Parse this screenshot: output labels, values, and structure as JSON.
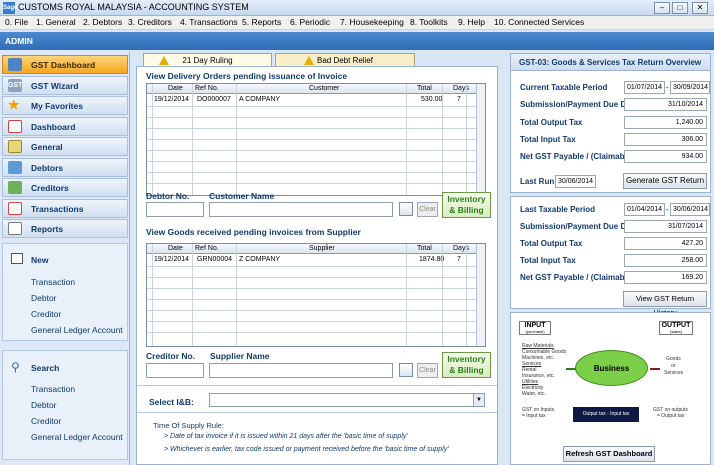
{
  "window": {
    "title": "CUSTOMS ROYAL MALAYSIA - ACCOUNTING SYSTEM",
    "logo": "Sage"
  },
  "menu": [
    "0. File",
    "1. General",
    "2. Debtors",
    "3. Creditors",
    "4. Transactions",
    "5. Reports",
    "6. Periodic",
    "7. Housekeeping",
    "8. Toolkits",
    "9. Help",
    "10. Connected Services"
  ],
  "user": "ADMIN",
  "sidebar": {
    "items": [
      {
        "label": "GST Dashboard",
        "icon": "gst-dashboard-icon"
      },
      {
        "label": "GST Wizard",
        "icon": "gst-wizard-icon"
      },
      {
        "label": "My Favorites",
        "icon": "star-icon"
      },
      {
        "label": "Dashboard",
        "icon": "dashboard-icon"
      },
      {
        "label": "General",
        "icon": "general-ledger-icon"
      },
      {
        "label": "Debtors",
        "icon": "debtors-icon"
      },
      {
        "label": "Creditors",
        "icon": "creditors-icon"
      },
      {
        "label": "Transactions",
        "icon": "transactions-icon"
      },
      {
        "label": "Reports",
        "icon": "reports-icon"
      }
    ],
    "new_section": {
      "title": "New",
      "links": [
        "Transaction",
        "Debtor",
        "Creditor",
        "General Ledger Account"
      ]
    },
    "search_section": {
      "title": "Search",
      "links": [
        "Transaction",
        "Debtor",
        "Creditor",
        "General Ledger Account"
      ]
    }
  },
  "tabs": [
    "21 Day Ruling",
    "Bad Debt Relief"
  ],
  "delivery": {
    "title": "View Delivery Orders pending issuance of Invoice",
    "columns": [
      "Date",
      "Ref No.",
      "Customer",
      "Total",
      "Days"
    ],
    "rows": [
      {
        "date": "19/12/2014",
        "ref": "DO000007",
        "party": "A COMPANY",
        "total": "530.00",
        "days": "7"
      }
    ],
    "debtor_label": "Debtor No.",
    "name_label": "Customer Name",
    "clear": "Clear",
    "inventory_button": [
      "Inventory",
      "& Billing"
    ]
  },
  "goods": {
    "title": "View Goods received pending invoices from Supplier",
    "columns": [
      "Date",
      "Ref No.",
      "Supplier",
      "Total",
      "Days"
    ],
    "rows": [
      {
        "date": "19/12/2014",
        "ref": "GRN00004",
        "party": "Z COMPANY",
        "total": "1874.80",
        "days": "7"
      }
    ],
    "creditor_label": "Creditor No.",
    "name_label": "Supplier Name",
    "clear": "Clear",
    "inventory_button": [
      "Inventory",
      "& Billing"
    ]
  },
  "select_label": "Select I&B:",
  "supply_rule": {
    "title": "Time Of Supply Rule:",
    "lines": [
      "> Date of tax invoice if it is issued within 21 days after the 'basic time of supply'",
      "> Whichever is earlier, tax code issued or payment received before the 'basic time of supply'"
    ]
  },
  "overview": {
    "title": "GST-03: Goods & Services Tax Return Overview",
    "current_period_label": "Current Taxable Period",
    "current_from": "01/07/2014",
    "current_sep": "-",
    "current_to": "30/09/2014",
    "due_label": "Submission/Payment Due Date",
    "due": "31/10/2014",
    "output_label": "Total Output Tax",
    "output": "1,240.00",
    "input_label": "Total Input Tax",
    "input": "306.00",
    "net_label": "Net GST Payable / (Claimable)",
    "net": "934.00",
    "lastrun_label": "Last Run",
    "lastrun": "30/06/2014",
    "generate_button": "Generate GST Return"
  },
  "last": {
    "period_label": "Last Taxable Period",
    "from": "01/04/2014",
    "sep": "-",
    "to": "30/06/2014",
    "due_label": "Submission/Payment Due Date",
    "due": "31/07/2014",
    "output_label": "Total Output Tax",
    "output": "427.20",
    "input_label": "Total Input Tax",
    "input": "258.00",
    "net_label": "Net GST Payable / (Claimable)",
    "net": "169.20",
    "history_button": "View GST Return History"
  },
  "diagram": {
    "input_title": "INPUT",
    "input_sub": "(purchase)",
    "output_title": "OUTPUT",
    "output_sub": "(sales)",
    "raw_materials": "Raw Materials",
    "consumables": "Consumable Goods",
    "machines": "Machines, etc.",
    "services": "Services",
    "rental": "Rental",
    "insurance": "Insurance, etc.",
    "utilities": "Utilities",
    "electricity": "Electricity",
    "water": "Water, etc.",
    "business": "Business",
    "goods": "Goods",
    "or": "or",
    "services_out": "Services",
    "gst_inputs": [
      "GST on Inputs",
      "= Input tax"
    ],
    "gst_outputs": [
      "GST on outputs",
      "= Output tax"
    ],
    "formula": "Output tax - Input tax"
  },
  "refresh_button": "Refresh GST Dashboard",
  "colors": {
    "accent": "#2f6db5",
    "active": "#f4a623",
    "green": "#2e7d1a"
  }
}
